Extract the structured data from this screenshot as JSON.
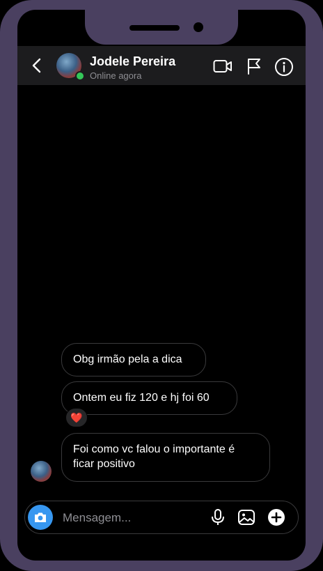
{
  "header": {
    "contact_name": "Jodele Pereira",
    "status": "Online agora",
    "icons": [
      "back-arrow-icon",
      "video-camera-icon",
      "flag-icon",
      "info-icon"
    ]
  },
  "messages": [
    {
      "text": "Obg irmão pela a dica"
    },
    {
      "text": "Ontem eu fiz 120 e hj foi 60",
      "reaction": "❤️"
    },
    {
      "text": "Foi como vc falou o importante é ficar positivo"
    }
  ],
  "composer": {
    "placeholder": "Mensagem...",
    "icons": [
      "camera-icon",
      "microphone-icon",
      "gallery-icon",
      "plus-icon"
    ]
  },
  "colors": {
    "accent": "#3797f0",
    "online": "#34c759",
    "frame": "#4a4060"
  }
}
